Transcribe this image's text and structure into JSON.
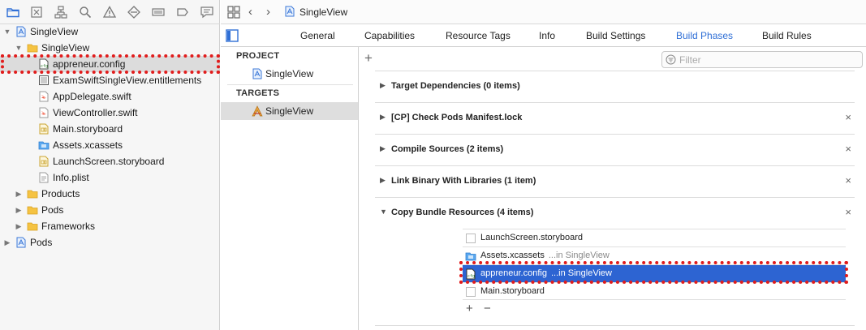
{
  "navigator": {
    "toolbar_icons": [
      "folder-icon",
      "source-control-icon",
      "hierarchy-icon",
      "search-icon",
      "warning-icon",
      "test-icon",
      "debug-icon",
      "breakpoint-icon",
      "report-icon"
    ],
    "tree": [
      {
        "label": "SingleView",
        "icon": "project-icon",
        "expanded": true
      },
      {
        "label": "SingleView",
        "icon": "folder-icon",
        "expanded": true
      },
      {
        "label": "appreneur.config",
        "icon": "config-icon"
      },
      {
        "label": "ExamSwiftSingleView.entitlements",
        "icon": "entitlements-icon"
      },
      {
        "label": "AppDelegate.swift",
        "icon": "swift-icon"
      },
      {
        "label": "ViewController.swift",
        "icon": "swift-icon"
      },
      {
        "label": "Main.storyboard",
        "icon": "storyboard-icon"
      },
      {
        "label": "Assets.xcassets",
        "icon": "assets-icon"
      },
      {
        "label": "LaunchScreen.storyboard",
        "icon": "storyboard-icon"
      },
      {
        "label": "Info.plist",
        "icon": "plist-icon"
      },
      {
        "label": "Products",
        "icon": "folder-icon",
        "expanded": false
      },
      {
        "label": "Pods",
        "icon": "folder-icon",
        "expanded": false
      },
      {
        "label": "Frameworks",
        "icon": "folder-icon",
        "expanded": false
      },
      {
        "label": "Pods",
        "icon": "project-icon",
        "expanded": false
      }
    ]
  },
  "jumpbar": {
    "file_name": "SingleView"
  },
  "tabs": [
    "General",
    "Capabilities",
    "Resource Tags",
    "Info",
    "Build Settings",
    "Build Phases",
    "Build Rules"
  ],
  "active_tab": "Build Phases",
  "targets_panel": {
    "project_header": "PROJECT",
    "project_item": "SingleView",
    "targets_header": "TARGETS",
    "target_item": "SingleView"
  },
  "phases_panel": {
    "add_label": "+",
    "filter_placeholder": "Filter",
    "phases": [
      {
        "title": "Target Dependencies (0 items)",
        "expanded": false,
        "removable": false
      },
      {
        "title": "[CP] Check Pods Manifest.lock",
        "expanded": false,
        "removable": true
      },
      {
        "title": "Compile Sources (2 items)",
        "expanded": false,
        "removable": true
      },
      {
        "title": "Link Binary With Libraries (1 item)",
        "expanded": false,
        "removable": true
      },
      {
        "title": "Copy Bundle Resources (4 items)",
        "expanded": true,
        "removable": true
      }
    ],
    "remove_symbol": "×",
    "resources": [
      {
        "name": "LaunchScreen.storyboard",
        "location": ""
      },
      {
        "name": "Assets.xcassets",
        "location": "...in SingleView"
      },
      {
        "name": "appreneur.config",
        "location": "...in SingleView"
      },
      {
        "name": "Main.storyboard",
        "location": ""
      }
    ],
    "add_resource": "+",
    "remove_resource": "−"
  },
  "colors": {
    "accent": "#2f6fd6",
    "selection": "#2d64d2",
    "highlight": "#e11c1c",
    "folder": "#f5c342"
  }
}
